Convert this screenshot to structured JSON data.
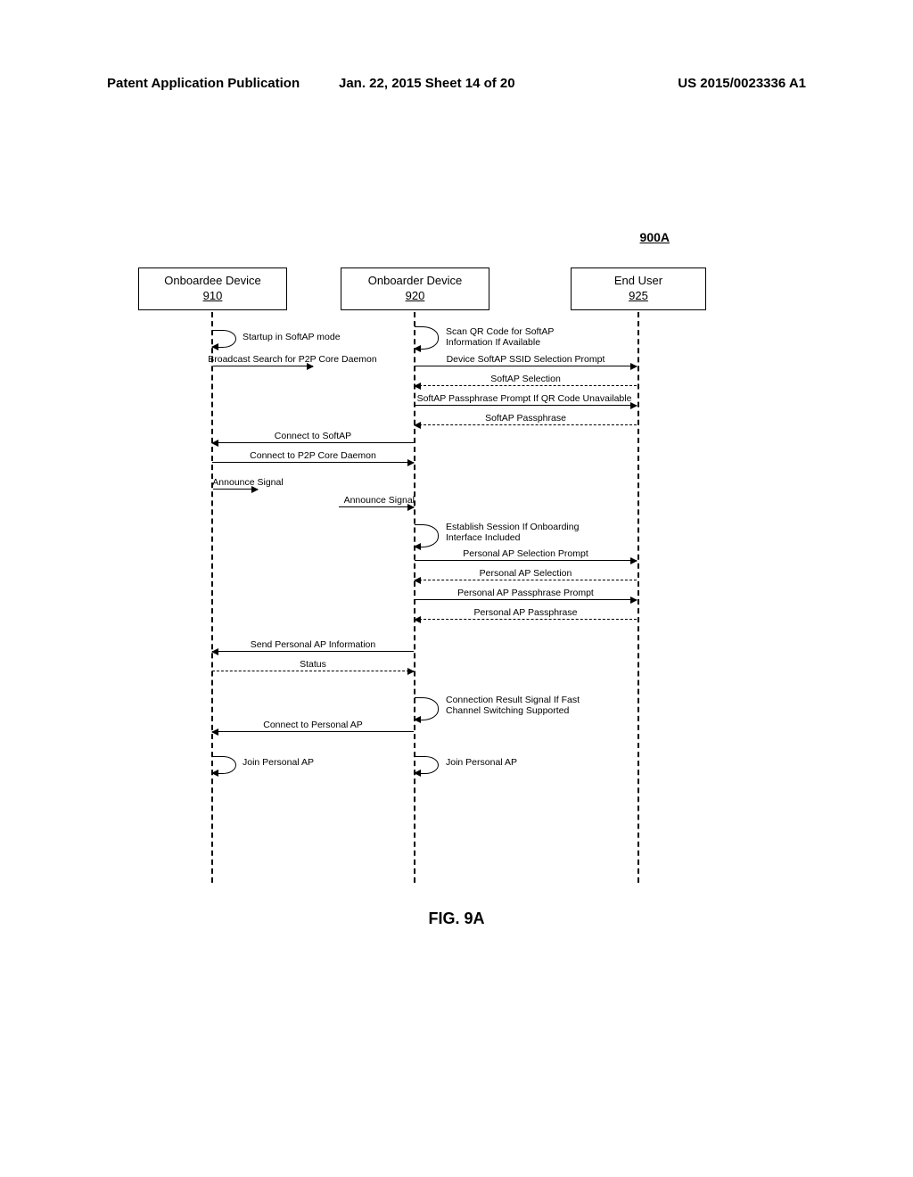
{
  "header": {
    "left": "Patent Application Publication",
    "center": "Jan. 22, 2015  Sheet 14 of 20",
    "right": "US 2015/0023336 A1"
  },
  "figure_ref": "900A",
  "participants": {
    "p1": {
      "name": "Onboardee Device",
      "num": "910"
    },
    "p2": {
      "name": "Onboarder Device",
      "num": "920"
    },
    "p3": {
      "name": "End User",
      "num": "925"
    }
  },
  "messages": {
    "startup": "Startup in SoftAP mode",
    "scan_qr": "Scan QR Code for SoftAP Information If Available",
    "broadcast": "Broadcast Search for P2P Core Daemon",
    "ssid_prompt": "Device SoftAP SSID Selection Prompt",
    "softap_sel": "SoftAP Selection",
    "pass_prompt": "SoftAP Passphrase Prompt If QR Code Unavailable",
    "softap_pass": "SoftAP Passphrase",
    "conn_softap": "Connect to SoftAP",
    "conn_daemon": "Connect to P2P Core Daemon",
    "announce1": "Announce Signal",
    "announce2": "Announce Signal",
    "establish": "Establish Session If Onboarding Interface Included",
    "pap_sel_prompt": "Personal AP Selection Prompt",
    "pap_sel": "Personal AP Selection",
    "pap_pass_prompt": "Personal AP Passphrase Prompt",
    "pap_pass": "Personal AP Passphrase",
    "send_pap": "Send Personal AP Information",
    "status": "Status",
    "conn_result": "Connection Result Signal If Fast Channel Switching Supported",
    "conn_pap": "Connect to Personal AP",
    "join_pap1": "Join Personal AP",
    "join_pap2": "Join Personal AP"
  },
  "figure_label": "FIG. 9A"
}
